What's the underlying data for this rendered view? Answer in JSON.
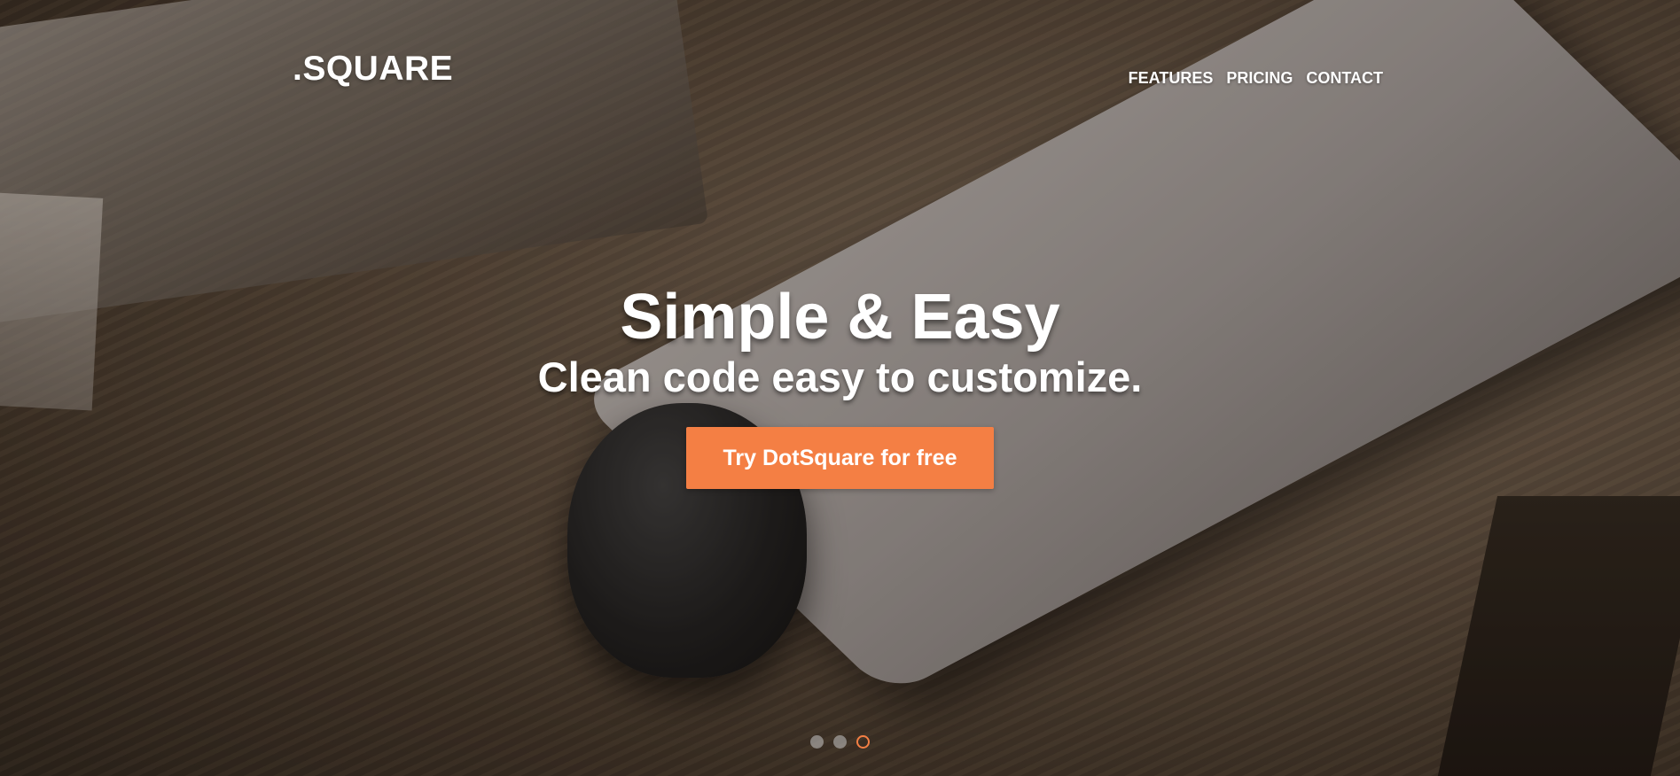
{
  "brand": {
    "logo_text": ".SQUARE"
  },
  "nav": {
    "items": [
      {
        "label": "FEATURES"
      },
      {
        "label": "PRICING"
      },
      {
        "label": "CONTACT"
      }
    ]
  },
  "hero": {
    "headline": "Simple & Easy",
    "subheadline": "Clean code easy to customize.",
    "cta_label": "Try DotSquare for free"
  },
  "slider": {
    "slide_count": 3,
    "active_index": 3
  },
  "colors": {
    "accent": "#f47f44",
    "text": "#ffffff"
  }
}
